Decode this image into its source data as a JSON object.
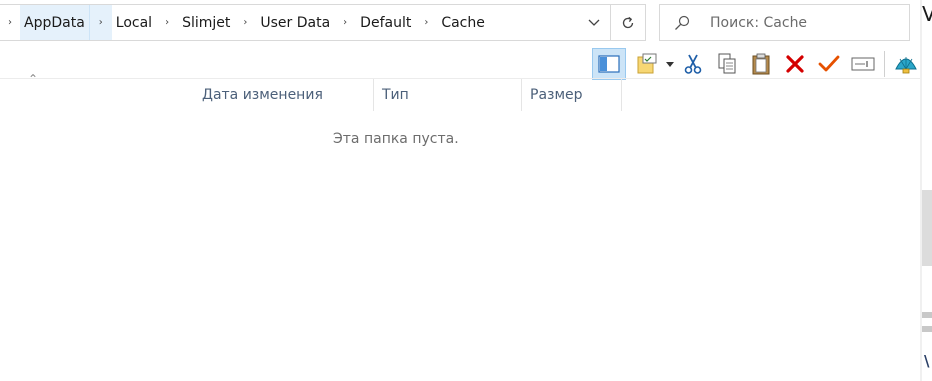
{
  "address_bar": {
    "crumbs": [
      "AppData",
      "Local",
      "Slimjet",
      "User Data",
      "Default",
      "Cache"
    ],
    "highlighted_crumb": "AppData"
  },
  "search": {
    "placeholder": "Поиск: Cache",
    "value": ""
  },
  "toolbar": {
    "icons": [
      "preview-pane-icon",
      "properties-icon",
      "dropdown-arrow-icon",
      "cut-icon",
      "copy-icon",
      "paste-icon",
      "delete-icon",
      "select-all-icon",
      "rename-icon",
      "shell-icon"
    ]
  },
  "columns": {
    "date": "Дата изменения",
    "type": "Тип",
    "size": "Размер"
  },
  "empty_message": "Эта папка пуста.",
  "right_edge_fragment": "V",
  "right_edge_fragment2": "\\",
  "colors": {
    "highlight_bg": "#e5f1fb",
    "active_button": "#cce4f7",
    "header_text": "#4c607a",
    "delete_red": "#d40000",
    "check_orange": "#e65100"
  }
}
